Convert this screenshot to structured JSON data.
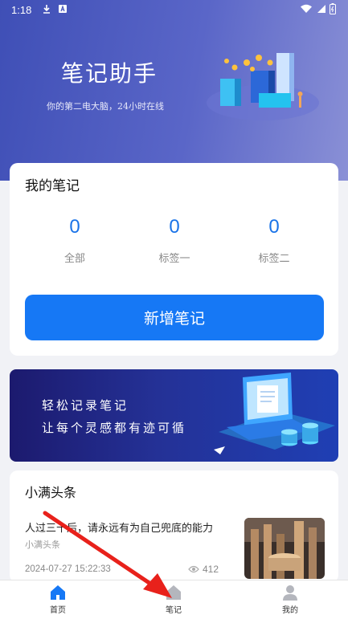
{
  "status_bar": {
    "time": "1:18"
  },
  "hero": {
    "title": "笔记助手",
    "subtitle": "你的第二电大脑，24小时在线"
  },
  "notes": {
    "title": "我的笔记",
    "stats": [
      {
        "value": "0",
        "label": "全部"
      },
      {
        "value": "0",
        "label": "标签一"
      },
      {
        "value": "0",
        "label": "标签二"
      }
    ],
    "add_button": "新增笔记"
  },
  "banner": {
    "line1": "轻松记录笔记",
    "line2": "让每个灵感都有迹可循"
  },
  "news": {
    "title": "小满头条",
    "items": [
      {
        "headline": "人过三十后，请永远有为自己兜底的能力",
        "source": "小满头条",
        "time": "2024-07-27 15:22:33",
        "views": "412"
      }
    ]
  },
  "tabbar": {
    "items": [
      {
        "label": "首页",
        "icon": "home-icon"
      },
      {
        "label": "笔记",
        "icon": "house-icon"
      },
      {
        "label": "我的",
        "icon": "user-icon"
      }
    ]
  },
  "colors": {
    "accent": "#1678f5",
    "stat_number": "#1a73e8",
    "hero_gradient_start": "#3f4fb6",
    "annotation_arrow": "#e8211b"
  }
}
